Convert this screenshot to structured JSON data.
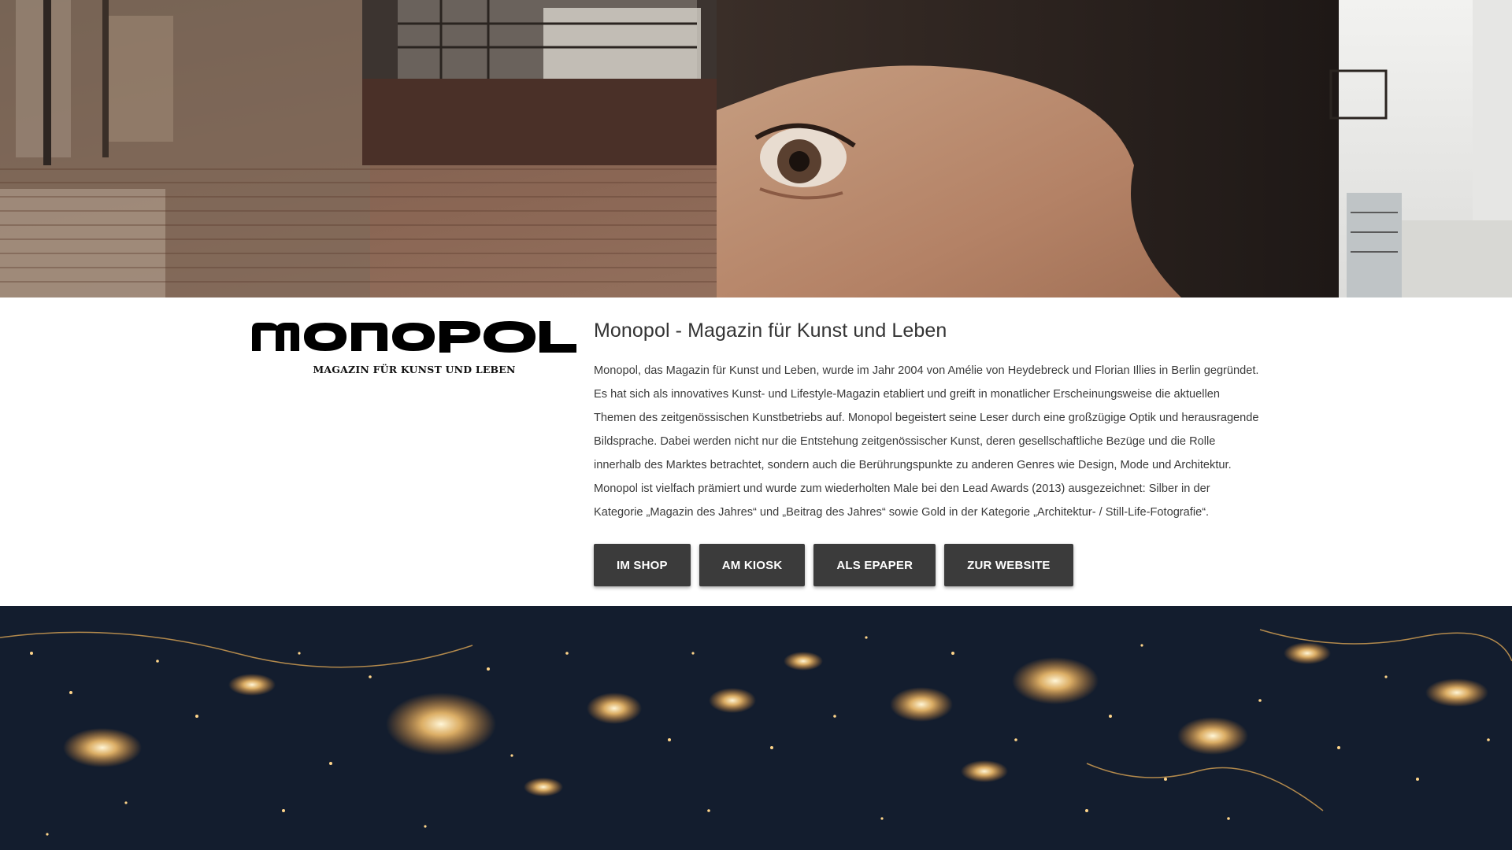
{
  "hero_top": {
    "description_icon": "mural-photo"
  },
  "brand": {
    "logo_text": "monopol",
    "tagline": "MAGAZIN FÜR KUNST UND LEBEN"
  },
  "main": {
    "title": "Monopol - Magazin für Kunst und Leben",
    "description": "Monopol, das Magazin für Kunst und Leben, wurde im Jahr 2004 von Amélie von Heydebreck und Florian Illies in Berlin gegründet. Es hat sich als innovatives Kunst- und Lifestyle-Magazin etabliert und greift in monatlicher Erscheinungsweise die aktuellen Themen des zeitgenössischen Kunstbetriebs auf. Monopol begeistert seine Leser durch eine großzügige Optik und herausragende Bildsprache. Dabei werden nicht nur die Entstehung zeitgenössischer Kunst, deren gesellschaftliche Bezüge und die Rolle innerhalb des Marktes betrachtet, sondern auch die Berührungspunkte zu anderen Genres wie Design, Mode und Architektur. Monopol ist vielfach prämiert und wurde zum wiederholten Male bei den Lead Awards (2013) ausgezeichnet: Silber in der Kategorie „Magazin des Jahres“ und „Beitrag des Jahres“ sowie Gold in der Kategorie „Architektur- / Still-Life-Fotografie“.",
    "buttons": [
      {
        "label": "IM SHOP"
      },
      {
        "label": "AM KIOSK"
      },
      {
        "label": "ALS EPAPER"
      },
      {
        "label": "ZUR WEBSITE"
      }
    ]
  },
  "colors": {
    "button_bg": "#3b3b3b",
    "button_text": "#ffffff",
    "title_text": "#333333",
    "body_text": "#3a3a3a"
  }
}
